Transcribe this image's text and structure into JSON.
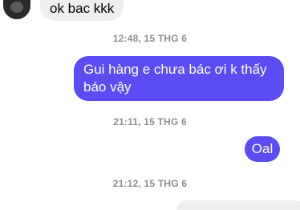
{
  "chat": {
    "incoming_message": {
      "text": "ok bac kkk"
    },
    "timestamps": [
      "12:48, 15 THG 6",
      "21:11, 15 THG 6",
      "21:12, 15 THG 6"
    ],
    "outgoing_messages": [
      "Gui hàng e chưa bác ơi k thấy báo vậy",
      "Oal"
    ]
  }
}
